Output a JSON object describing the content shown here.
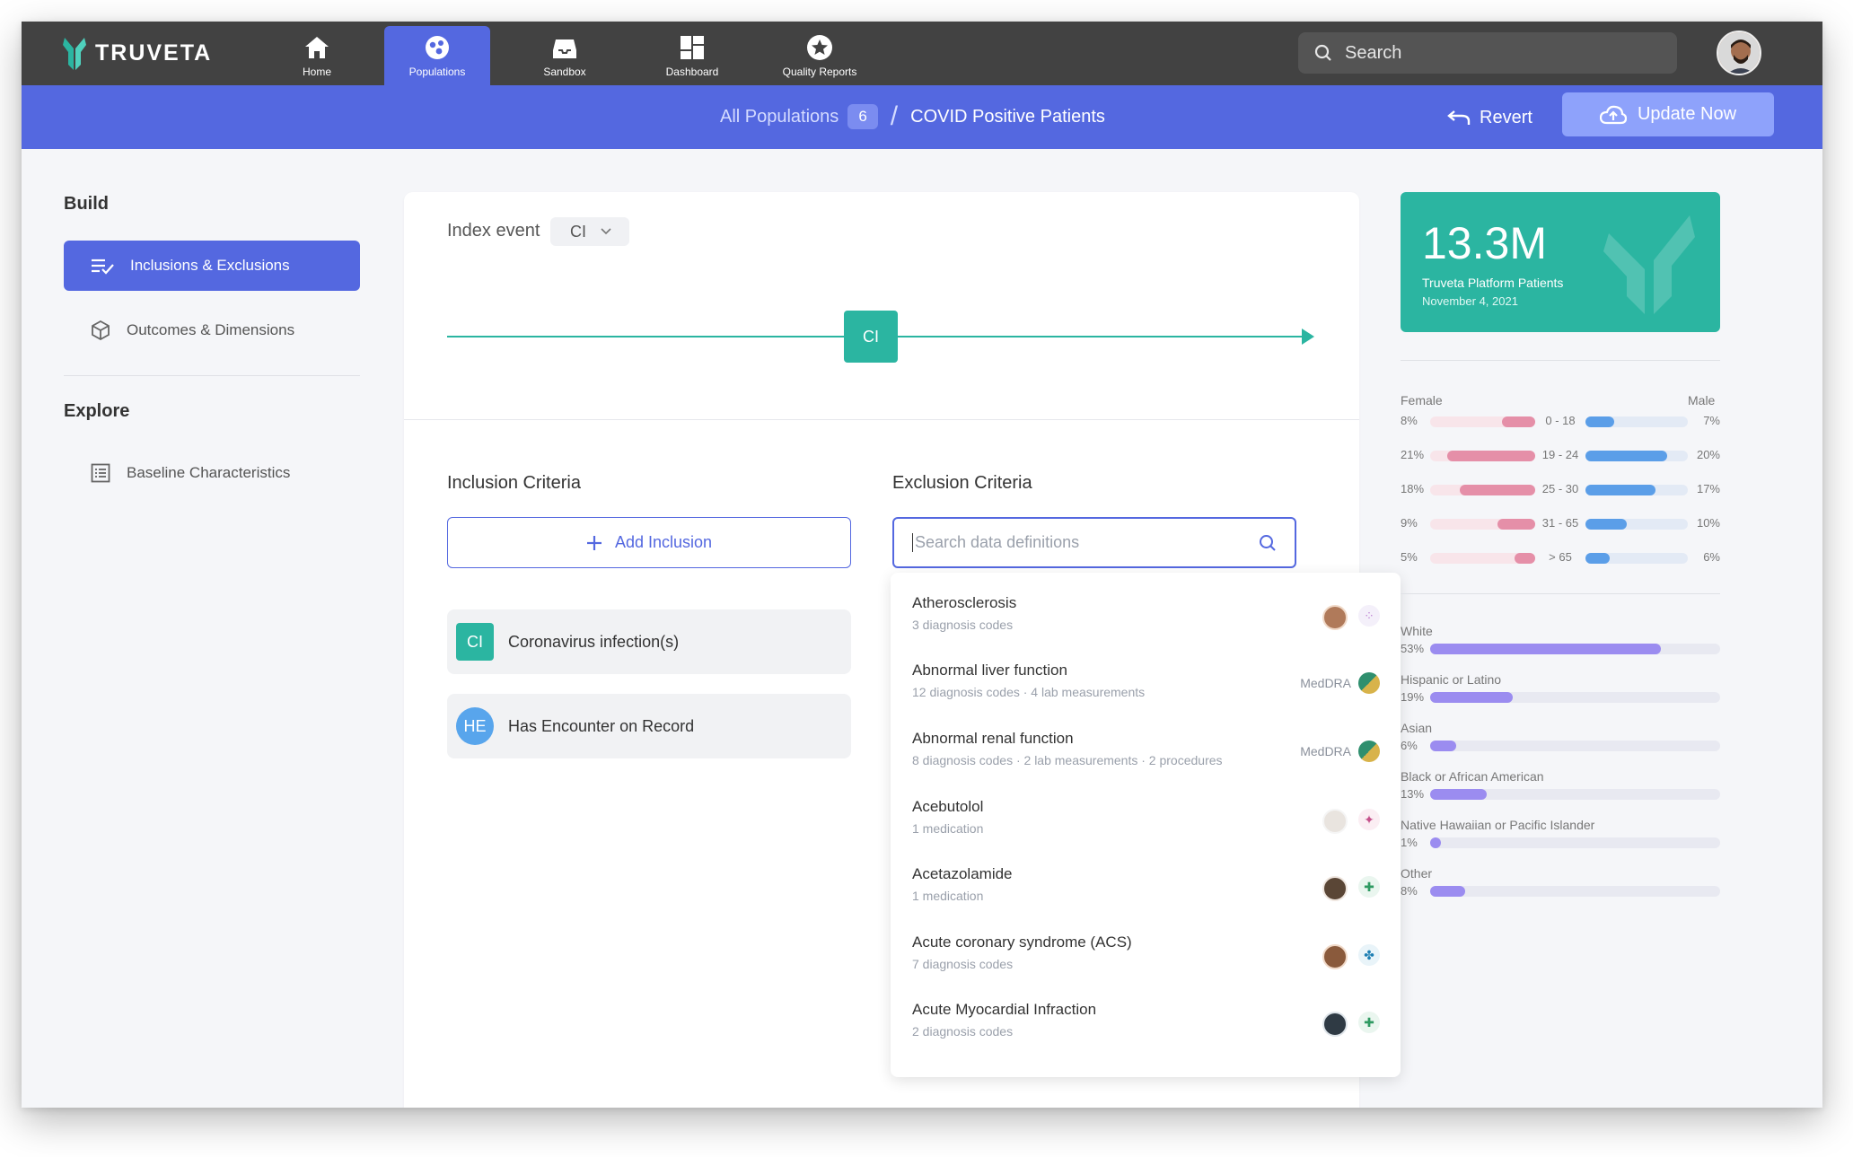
{
  "nav": {
    "logo_text": "TRUVETA",
    "items": [
      {
        "label": "Home",
        "icon": "home-icon"
      },
      {
        "label": "Populations",
        "icon": "populations-icon"
      },
      {
        "label": "Sandbox",
        "icon": "sandbox-icon"
      },
      {
        "label": "Dashboard",
        "icon": "dashboard-icon"
      },
      {
        "label": "Quality Reports",
        "icon": "star-badge-icon"
      }
    ],
    "active": "Populations",
    "search_placeholder": "Search"
  },
  "subbar": {
    "breadcrumb_root": "All Populations",
    "population_count": "6",
    "breadcrumb_current": "COVID Positive Patients",
    "revert_label": "Revert",
    "update_label": "Update Now"
  },
  "sidebar": {
    "build_heading": "Build",
    "build_items": [
      {
        "label": "Inclusions & Exclusions",
        "icon": "list-check-icon",
        "active": true
      },
      {
        "label": "Outcomes & Dimensions",
        "icon": "cube-icon",
        "active": false
      }
    ],
    "explore_heading": "Explore",
    "explore_items": [
      {
        "label": "Baseline Characteristics",
        "icon": "table-list-icon"
      }
    ]
  },
  "main": {
    "index_event_label": "Index event",
    "index_event_value": "CI",
    "timeline_node": "CI",
    "inclusion_title": "Inclusion Criteria",
    "add_inclusion_label": "Add Inclusion",
    "inclusions": [
      {
        "badge": "CI",
        "label": "Coronavirus infection(s)"
      },
      {
        "badge": "HE",
        "label": "Has Encounter on Record"
      }
    ],
    "exclusion_title": "Exclusion Criteria",
    "exclusion_search_placeholder": "Search data definitions"
  },
  "dropdown": {
    "items": [
      {
        "title": "Atherosclerosis",
        "sub": "3 diagnosis codes",
        "source": ""
      },
      {
        "title": "Abnormal liver function",
        "sub": "12 diagnosis codes · 4 lab measurements",
        "source": "MedDRA"
      },
      {
        "title": "Abnormal renal function",
        "sub": "8 diagnosis codes · 2 lab measurements · 2 procedures",
        "source": "MedDRA"
      },
      {
        "title": "Acebutolol",
        "sub": "1 medication",
        "source": ""
      },
      {
        "title": "Acetazolamide",
        "sub": "1 medication",
        "source": ""
      },
      {
        "title": "Acute coronary syndrome (ACS)",
        "sub": "7 diagnosis codes",
        "source": ""
      },
      {
        "title": "Acute Myocardial Infraction",
        "sub": "2 diagnosis codes",
        "source": ""
      }
    ]
  },
  "stats": {
    "total": "13.3M",
    "total_label": "Truveta Platform Patients",
    "date": "November 4, 2021",
    "pyramid": {
      "female_label": "Female",
      "male_label": "Male",
      "rows": [
        {
          "age": "0 - 18",
          "female": "8%",
          "male": "7%",
          "female_val": 8,
          "male_val": 7
        },
        {
          "age": "19 - 24",
          "female": "21%",
          "male": "20%",
          "female_val": 21,
          "male_val": 20
        },
        {
          "age": "25 - 30",
          "female": "18%",
          "male": "17%",
          "female_val": 18,
          "male_val": 17
        },
        {
          "age": "31 - 65",
          "female": "9%",
          "male": "10%",
          "female_val": 9,
          "male_val": 10
        },
        {
          "age": "> 65",
          "female": "5%",
          "male": "6%",
          "female_val": 5,
          "male_val": 6
        }
      ]
    },
    "ethnicity": [
      {
        "name": "White",
        "pct": "53%",
        "val": 53
      },
      {
        "name": "Hispanic or Latino",
        "pct": "19%",
        "val": 19
      },
      {
        "name": "Asian",
        "pct": "6%",
        "val": 6
      },
      {
        "name": "Black or African American",
        "pct": "13%",
        "val": 13
      },
      {
        "name": "Native Hawaiian or Pacific Islander",
        "pct": "1%",
        "val": 1
      },
      {
        "name": "Other",
        "pct": "8%",
        "val": 8
      }
    ],
    "colors": {
      "teal": "#2bb5a1",
      "primary": "#5468e0",
      "female_bar": "#e58fa8",
      "male_bar": "#5b9ee8",
      "ethnicity_bar": "#9b8cf0"
    }
  }
}
